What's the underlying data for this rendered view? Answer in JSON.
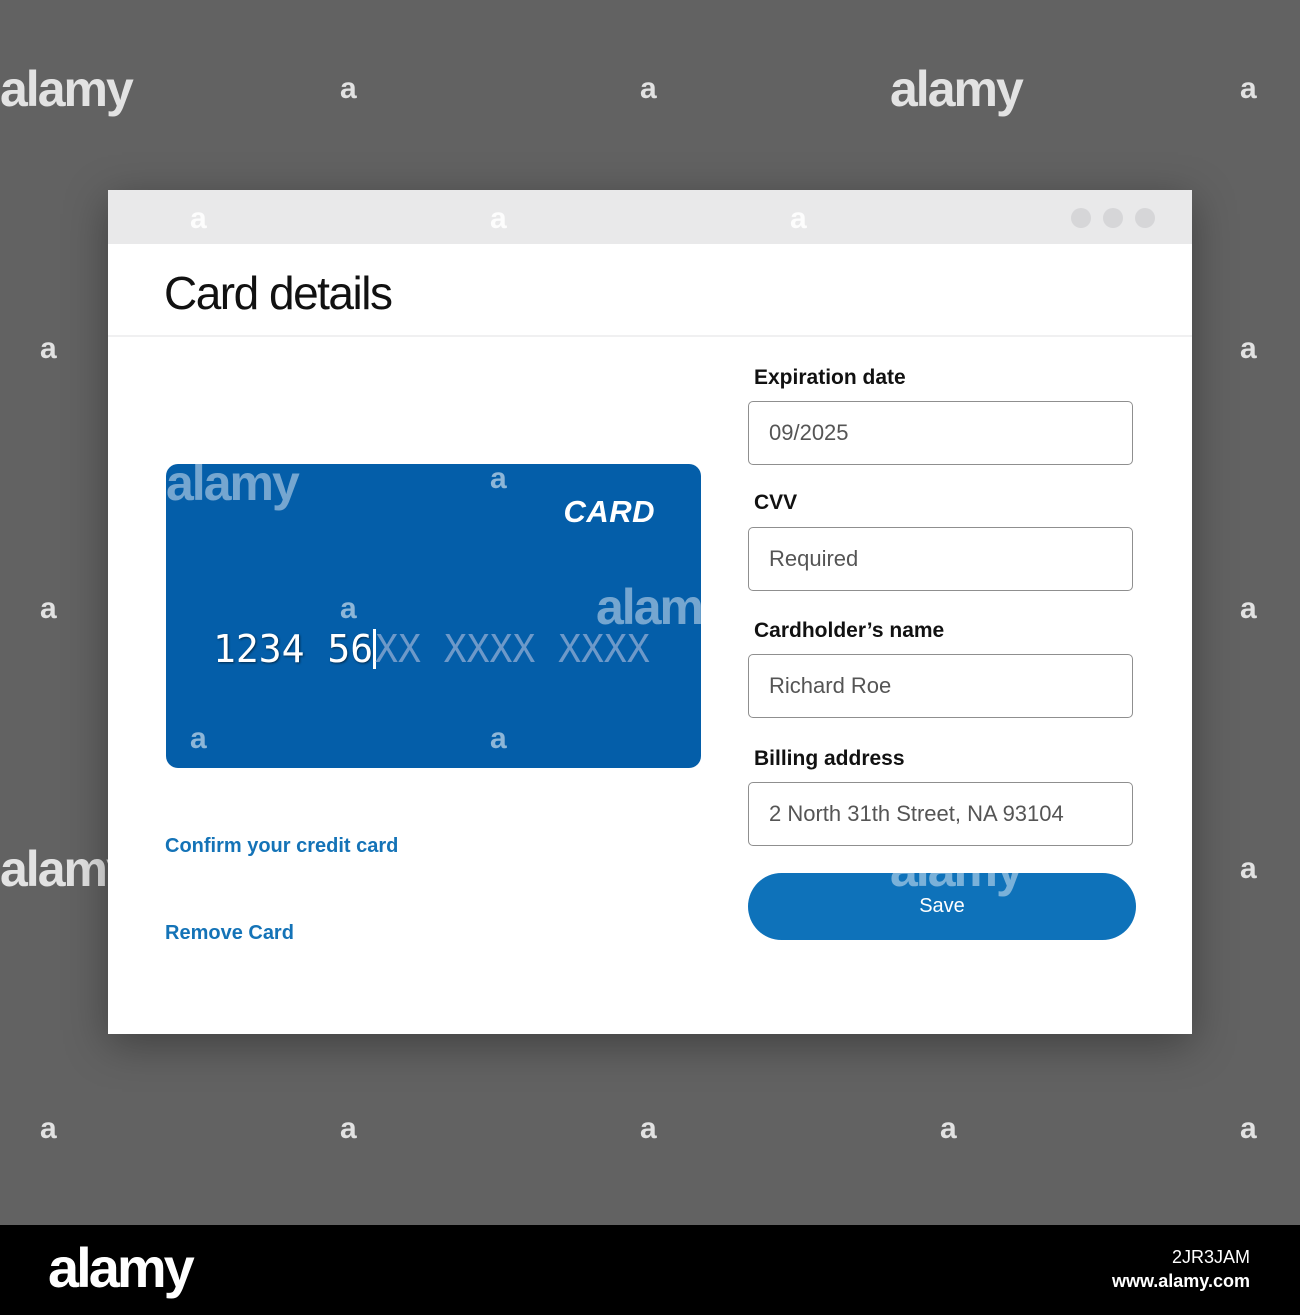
{
  "window": {
    "title": "Card details"
  },
  "card": {
    "brand": "CARD",
    "number_typed": "1234 56",
    "number_placeholder": "XX XXXX XXXX"
  },
  "links": {
    "confirm": "Confirm your credit card",
    "remove": "Remove Card"
  },
  "form": {
    "expiration": {
      "label": "Expiration date",
      "value": "09/2025"
    },
    "cvv": {
      "label": "CVV",
      "placeholder": "Required"
    },
    "name": {
      "label": "Cardholder’s name",
      "value": "Richard Roe"
    },
    "address": {
      "label": "Billing address",
      "value": "2 North 31th Street, NA 93104"
    },
    "save_label": "Save"
  },
  "watermark": {
    "logo": "alamy",
    "letter": "a",
    "image_id": "2JR3JAM",
    "url": "www.alamy.com"
  },
  "colors": {
    "background": "#626262",
    "card": "#045ea9",
    "accent": "#0e72ba",
    "link": "#1473b7"
  }
}
